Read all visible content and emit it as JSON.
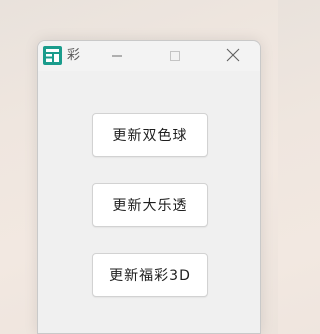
{
  "window": {
    "title": "彩"
  },
  "buttons": {
    "ssq": "更新双色球",
    "dlt": "更新大乐透",
    "fc3d": "更新福彩3D"
  },
  "icons": {
    "app": "lottery-app-icon",
    "minimize": "minimize-icon",
    "maximize": "maximize-icon",
    "close": "close-icon"
  },
  "colors": {
    "app_icon": "#1a9c8c",
    "window_bg": "#f0f0f0",
    "button_bg": "#ffffff"
  }
}
